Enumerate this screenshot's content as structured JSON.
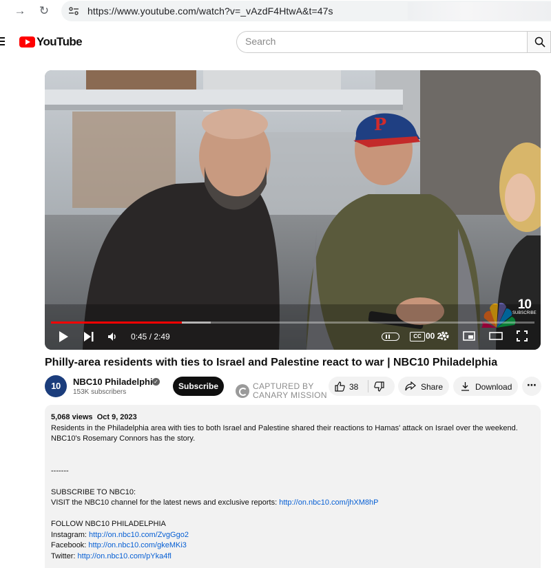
{
  "browser": {
    "url": "https://www.youtube.com/watch?v=_vAzdF4HtwA&t=47s"
  },
  "header": {
    "logo_text": "YouTube",
    "search_placeholder": "Search"
  },
  "player": {
    "current_time": "0:45",
    "duration": "2:49",
    "time_display": "0:45 / 2:49",
    "played_fraction": 0.27,
    "buffered_fraction": 0.33,
    "watermark_number": "10",
    "watermark_sub": "SUBSCRIBE",
    "cc_label": "CC",
    "overlay_temp": "00 2°"
  },
  "video": {
    "title": "Philly-area residents with ties to Israel and Palestine react to war | NBC10 Philadelphia"
  },
  "channel": {
    "avatar_text": "10",
    "name": "NBC10 Philadelphia",
    "subscribers": "153K subscribers",
    "subscribe_label": "Subscribe"
  },
  "extension_badge": {
    "line1": "CAPTURED BY",
    "line2": "CANARY MISSION"
  },
  "actions": {
    "like_count": "38",
    "share_label": "Share",
    "download_label": "Download",
    "more_label": "⋯"
  },
  "description": {
    "views": "5,068 views",
    "date": "Oct 9, 2023",
    "para1_line1": "Residents in the Philadelphia area with ties to both Israel and Palestine shared their reactions to Hamas' attack on Israel over the weekend.",
    "para1_line2": "NBC10's Rosemary Connors has the story.",
    "divider": "-------",
    "subscribe_heading": "SUBSCRIBE TO NBC10:",
    "visit_text": "VISIT the NBC10 channel for the latest news and exclusive reports: ",
    "visit_link": "http://on.nbc10.com/jhXM8hP",
    "follow_heading": "FOLLOW NBC10 PHILADELPHIA",
    "instagram_label": "Instagram: ",
    "instagram_link": "http://on.nbc10.com/ZvgGgo2",
    "facebook_label": "Facebook: ",
    "facebook_link": "http://on.nbc10.com/gkeMKi3",
    "twitter_label": "Twitter: ",
    "twitter_link": "http://on.nbc10.com/pYka4fl"
  }
}
